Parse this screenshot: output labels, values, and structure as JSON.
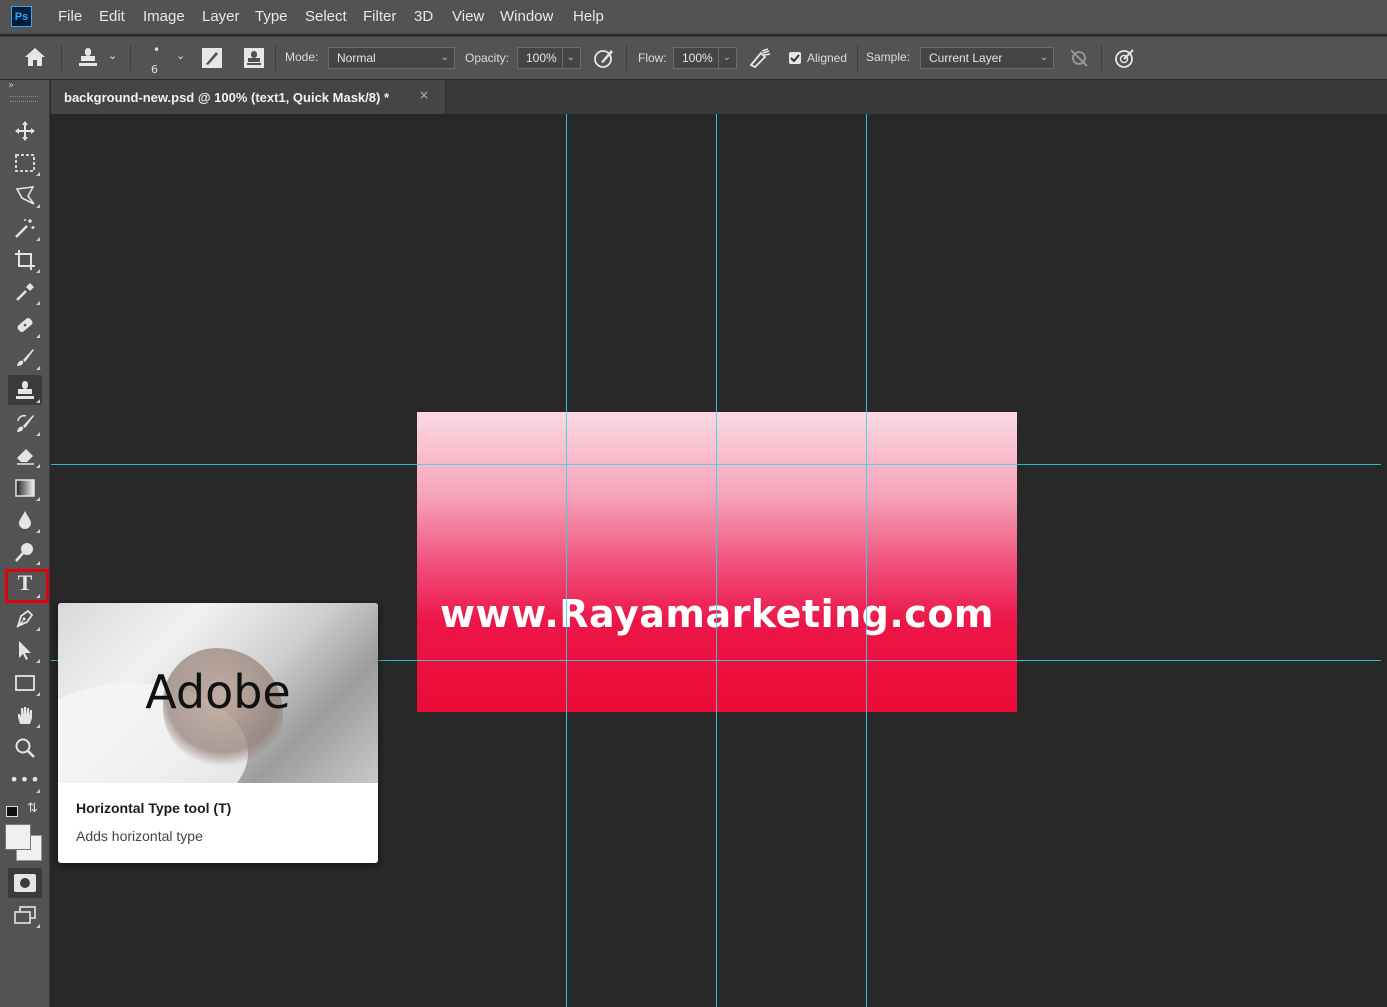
{
  "app": {
    "logo": "Ps"
  },
  "menu": [
    "File",
    "Edit",
    "Image",
    "Layer",
    "Type",
    "Select",
    "Filter",
    "3D",
    "View",
    "Window",
    "Help"
  ],
  "options_bar": {
    "brush_size": "6",
    "mode_label": "Mode:",
    "mode_value": "Normal",
    "opacity_label": "Opacity:",
    "opacity_value": "100%",
    "flow_label": "Flow:",
    "flow_value": "100%",
    "aligned_label": "Aligned",
    "aligned_checked": true,
    "sample_label": "Sample:",
    "sample_value": "Current Layer"
  },
  "document_tab": {
    "label": "background-new.psd @ 100% (text1, Quick Mask/8) *",
    "close": "×"
  },
  "toolbar": {
    "tools": [
      "move",
      "rectangular-marquee",
      "lasso",
      "magic-wand",
      "crop",
      "eyedropper",
      "spot-healing-brush",
      "brush",
      "clone-stamp",
      "history-brush",
      "eraser",
      "gradient",
      "blur",
      "dodge",
      "horizontal-type",
      "pen",
      "path-selection",
      "rectangle",
      "hand",
      "zoom",
      "more-tools"
    ],
    "active_tool": "clone-stamp",
    "highlighted_tool": "horizontal-type",
    "highlight_color": "#e1000f"
  },
  "canvas": {
    "artboard_text": "www.Rayamarketing.com",
    "gradient_top_color": "#fbd9e3",
    "gradient_bottom_color": "#eb0a36",
    "guide_color": "#2fd7e6"
  },
  "tooltip": {
    "brand": "Adobe",
    "title": "Horizontal Type tool (T)",
    "description": "Adds horizontal type"
  }
}
